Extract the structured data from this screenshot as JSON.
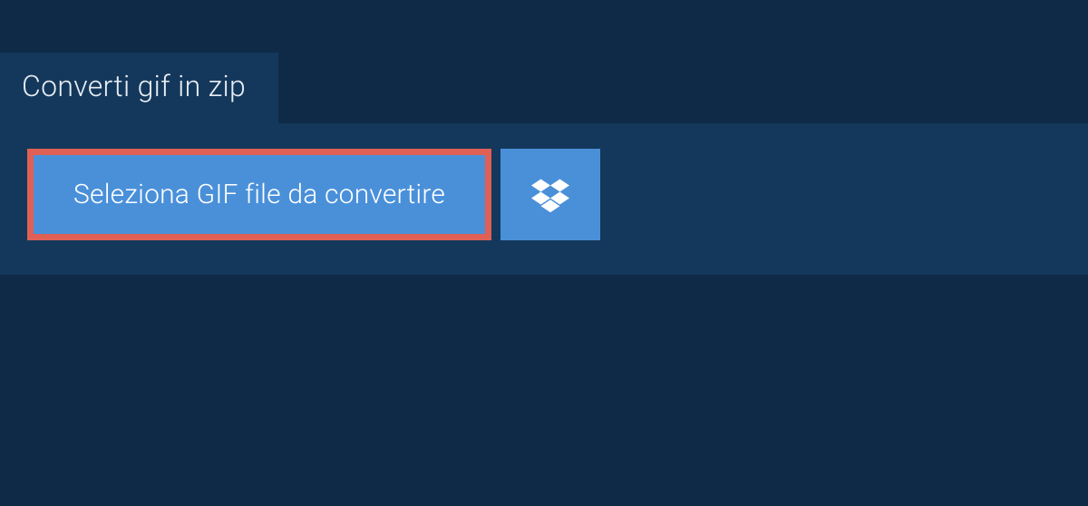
{
  "tab": {
    "title": "Converti gif in zip"
  },
  "actions": {
    "select_label": "Seleziona GIF file da convertire"
  },
  "colors": {
    "background": "#0e2a47",
    "panel": "#14385b",
    "button": "#4a90d9",
    "highlight_border": "#e06055",
    "text_light": "#ffffff"
  }
}
